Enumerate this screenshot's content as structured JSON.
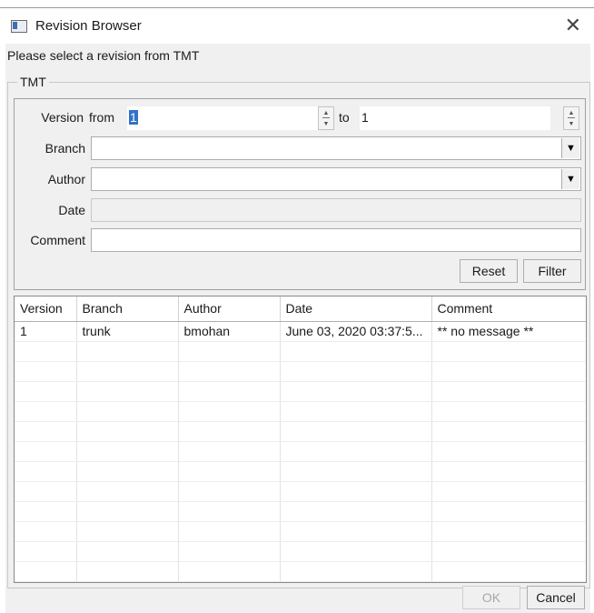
{
  "window": {
    "title": "Revision Browser",
    "close_icon": "close-icon",
    "app_icon": "app-window-icon"
  },
  "prompt": "Please select a revision from TMT",
  "group": {
    "label": "TMT"
  },
  "filter": {
    "version_label": "Version",
    "from_label": "from",
    "from_value": "1",
    "to_label": "to",
    "to_value": "1",
    "branch_label": "Branch",
    "branch_value": "",
    "author_label": "Author",
    "author_value": "",
    "date_label": "Date",
    "date_value": "",
    "comment_label": "Comment",
    "comment_value": "",
    "reset_label": "Reset",
    "filter_label": "Filter"
  },
  "table": {
    "columns": [
      "Version",
      "Branch",
      "Author",
      "Date",
      "Comment"
    ],
    "rows": [
      [
        "1",
        "trunk",
        "bmohan",
        "June 03, 2020 03:37:5...",
        "** no message **"
      ],
      [
        "",
        "",
        "",
        "",
        ""
      ],
      [
        "",
        "",
        "",
        "",
        ""
      ],
      [
        "",
        "",
        "",
        "",
        ""
      ],
      [
        "",
        "",
        "",
        "",
        ""
      ],
      [
        "",
        "",
        "",
        "",
        ""
      ],
      [
        "",
        "",
        "",
        "",
        ""
      ],
      [
        "",
        "",
        "",
        "",
        ""
      ],
      [
        "",
        "",
        "",
        "",
        ""
      ],
      [
        "",
        "",
        "",
        "",
        ""
      ],
      [
        "",
        "",
        "",
        "",
        ""
      ],
      [
        "",
        "",
        "",
        "",
        ""
      ],
      [
        "",
        "",
        "",
        "",
        ""
      ]
    ]
  },
  "footer": {
    "ok_label": "OK",
    "cancel_label": "Cancel"
  },
  "colors": {
    "selection": "#3173c7",
    "dialog_bg": "#f0f0f0"
  }
}
